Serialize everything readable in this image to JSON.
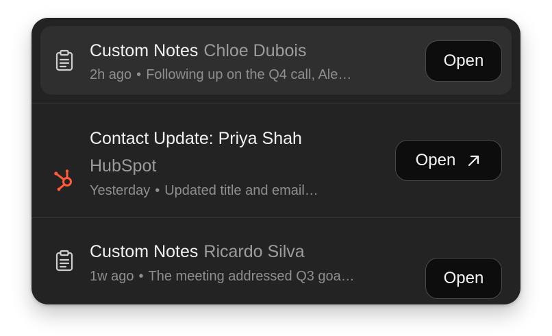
{
  "colors": {
    "card_bg": "#232323",
    "highlight_bg": "#2f2f2f",
    "button_bg": "#0d0d0d",
    "hubspot_orange": "#ff5c35"
  },
  "items": [
    {
      "icon": "clipboard-icon",
      "title": "Custom Notes",
      "person": "Chloe Dubois",
      "time": "2h ago",
      "separator": "•",
      "snippet": "Following up on the Q4 call, Ale…",
      "button_label": "Open",
      "highlighted": true
    },
    {
      "icon": "hubspot-icon",
      "title": "Contact Update: Priya Shah",
      "source": "HubSpot",
      "time": "Yesterday",
      "separator": "•",
      "snippet": "Updated title and email…",
      "button_label": "Open",
      "external": true
    },
    {
      "icon": "clipboard-icon",
      "title": "Custom Notes",
      "person": "Ricardo Silva",
      "time": "1w ago",
      "separator": "•",
      "snippet": "The meeting addressed Q3 goa…",
      "button_label": "Open"
    }
  ]
}
